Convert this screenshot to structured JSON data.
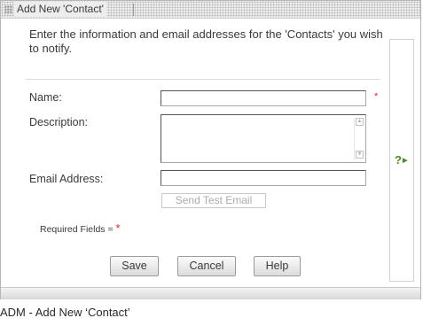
{
  "dialog": {
    "title": "Add New 'Contact'"
  },
  "intro_text": "Enter the information and email addresses for the 'Contacts' you wish to notify.",
  "form": {
    "name_label": "Name:",
    "name_value": "",
    "description_label": "Description:",
    "description_value": "",
    "email_label": "Email Address:",
    "email_value": "",
    "send_test_email_label": "Send Test Email",
    "required_star": "*",
    "required_fields_label": "Required Fields =",
    "required_fields_star": "*"
  },
  "buttons": {
    "save": "Save",
    "cancel": "Cancel",
    "help": "Help"
  },
  "help_panel": {
    "toggle_label": "?",
    "toggle_arrow": "▶",
    "icon": "expand-help-icon"
  },
  "caption": "ADM - Add New ‘Contact’",
  "colors": {
    "required": "#d22b2b",
    "help_accent": "#4a8a1e"
  }
}
